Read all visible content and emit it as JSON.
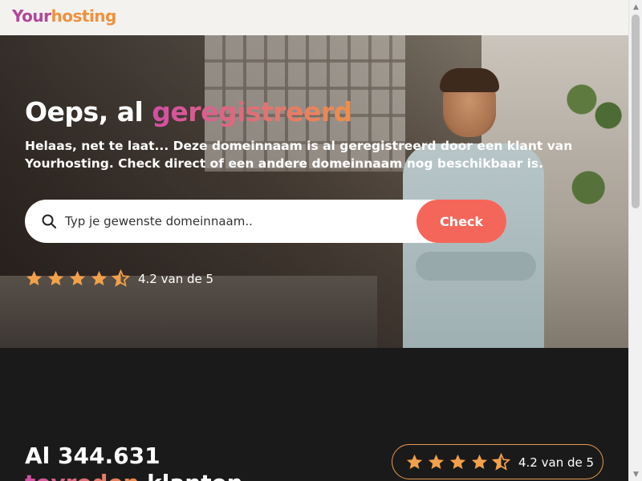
{
  "header": {
    "logo_part_a": "Your",
    "logo_part_b": "hosting"
  },
  "hero": {
    "title_prefix": "Oeps, al ",
    "title_highlight": "geregistreerd",
    "subtitle": "Helaas, net te laat... Deze domeinnaam is al geregistreerd door een klant van Yourhosting. Check direct of een andere domeinnaam nog beschikbaar is.",
    "search": {
      "placeholder": "Typ je gewenste domeinnaam..",
      "value": "",
      "button_label": "Check",
      "icon": "search-icon"
    },
    "rating": {
      "stars": 4.5,
      "text": "4.2 van de 5"
    }
  },
  "stats": {
    "line1": "Al 344.631",
    "line2_highlight": "tevreden",
    "line2_rest": " klanten",
    "rating_text": "4.2 van de 5",
    "rating_stars": 4.5
  },
  "colors": {
    "accent": "#f4665a",
    "gradient_start": "#d14ea5",
    "gradient_end": "#f08f4a",
    "star": "#f2a04a",
    "dark_bg": "#1b1a1a"
  }
}
